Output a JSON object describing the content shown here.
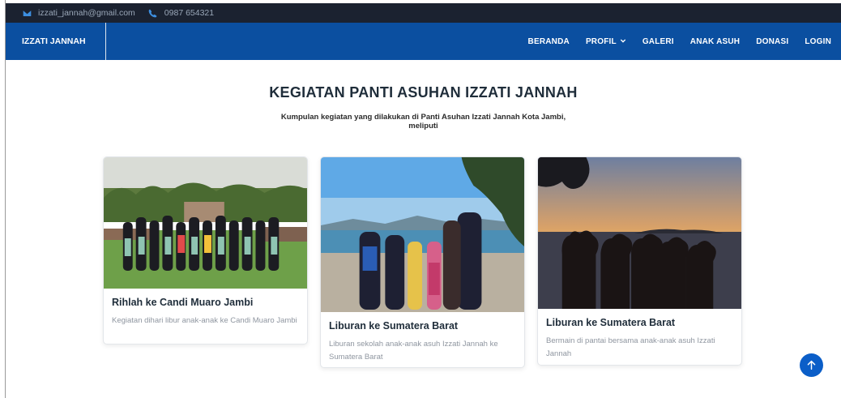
{
  "topbar": {
    "email": "izzati_jannah@gmail.com",
    "phone": "0987 654321"
  },
  "navbar": {
    "brand": "IZZATI JANNAH",
    "menu": [
      "BERANDA",
      "PROFIL",
      "GALERI",
      "ANAK ASUH",
      "DONASI",
      "LOGIN"
    ]
  },
  "hero": {
    "title": "KEGIATAN PANTI ASUHAN IZZATI JANNAH",
    "subtitle": "Kumpulan kegiatan yang dilakukan di Panti Asuhan Izzati Jannah Kota Jambi, meliputi"
  },
  "cards": [
    {
      "title": "Rihlah ke Candi Muaro Jambi",
      "desc": "Kegiatan dihari libur anak-anak ke Candi Muaro Jambi"
    },
    {
      "title": "Liburan ke Sumatera Barat",
      "desc": "Liburan sekolah anak-anak asuh Izzati Jannah ke Sumatera Barat"
    },
    {
      "title": "Liburan ke Sumatera Barat",
      "desc": "Bermain di pantai bersama anak-anak asuh Izzati Jannah"
    }
  ],
  "colors": {
    "topbar": "#1b2230",
    "navbar": "#0b4fa0",
    "accent": "#0b5ec8"
  },
  "icons": [
    "envelope-icon",
    "phone-icon",
    "chevron-down-icon",
    "arrow-up-icon"
  ]
}
